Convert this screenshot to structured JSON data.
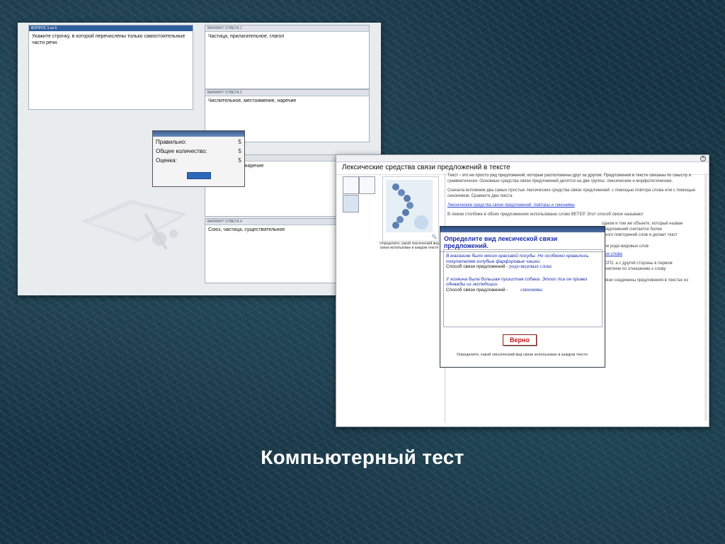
{
  "screen1": {
    "question_header": "ВОПРОС 5 из 5",
    "question_text": "Укажите строчку, в которой перечислены только самостоятельные части речи.",
    "answers": [
      {
        "header": "ВАРИАНТ ОТВЕТА 1",
        "text": "Частица, прилагательное, глагол"
      },
      {
        "header": "ВАРИАНТ ОТВЕТА 2",
        "text": "Числительное, местоимение, наречие"
      },
      {
        "header": "ВАРИАНТ ОТВЕТА 3",
        "text": "г, наречие"
      },
      {
        "header": "ВАРИАНТ ОТВЕТА 4",
        "text": "Союз, частица, существительное"
      }
    ],
    "result": {
      "rows": [
        {
          "label": "Правильно:",
          "value": "5"
        },
        {
          "label": "Общее количество:",
          "value": "5"
        },
        {
          "label": "Оценка:",
          "value": "5"
        }
      ]
    }
  },
  "screen2": {
    "title": "Лексические средства связи предложений в тексте",
    "image_caption": "Определите, какой лексический вид связи использован в каждом тексте",
    "paragraphs": [
      "Текст - это не просто ряд предложений, которые расположены друг за другом. Предложения в тексте связаны по смыслу и грамматически. Основные средства связи предложений делятся на две группы: лексические и морфологические.",
      "Сначала вспомним два самых простые лексических средства связи предложений: с помощью повтора слова или с помощью синонимов. Сравните два текста"
    ],
    "link_text": "Лексические средства связи предложений: повторы и синонимы",
    "paragraph3": "В левом столбике в обоих предложениях использовано слово ВЕТЕР. Этот способ связи называют",
    "side_lines": [
      "одном и том же объекте, который назван",
      "предложений считается более",
      "много повторений слов и делает текст",
      "",
      "или родо-видовых слов",
      "вые слова",
      "ВОГО, а с другой стороны в первом",
      "понятием по отношению к слову",
      "",
      "связи соединены предложения в текстах из"
    ],
    "dialog": {
      "question": "Определите вид лексической связи предложений.",
      "example1": "В магазине было много красивой посуды.  Но особенно нравились покупателям голубые фарфоровые чашки.",
      "way1_label": "Способ связи предложений -",
      "way1_answer": "родо-видовые слова",
      "example2": "У хозяина была большая пушистая собака. Этого пса он привез однажды из  экспедиции.",
      "way2_label": "Способ связи предложений -",
      "way2_answer": "синонимы",
      "result_button": "Верно",
      "footer": "Определите, какой лексический вид связи  использован в каждом тексте"
    }
  },
  "caption": "Компьютерный тест"
}
